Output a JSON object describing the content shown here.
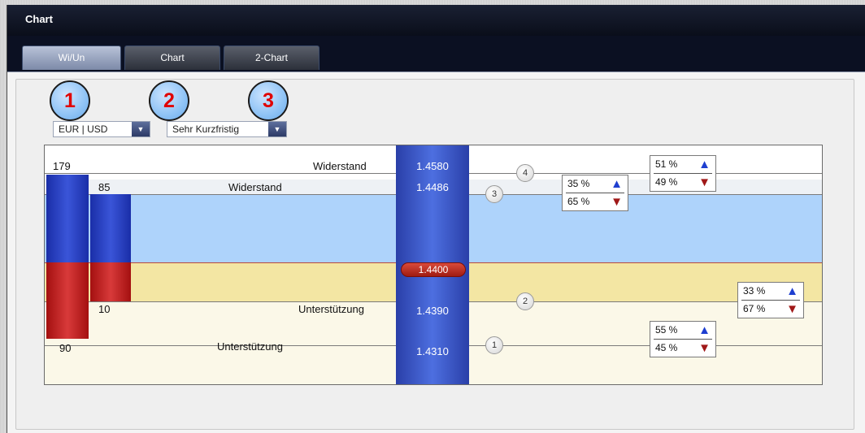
{
  "window": {
    "title": "Chart"
  },
  "tabs": [
    {
      "label": "Wi/Un",
      "active": true
    },
    {
      "label": "Chart",
      "active": false
    },
    {
      "label": "2-Chart",
      "active": false
    }
  ],
  "selectors": {
    "pair": {
      "value": "EUR | USD"
    },
    "horizon": {
      "value": "Sehr Kurzfristig"
    }
  },
  "badges": [
    "1",
    "2",
    "3"
  ],
  "levels": {
    "r2": {
      "count": "179",
      "label": "Widerstand",
      "price": "1.4580",
      "marker": "4",
      "up": "51 %",
      "down": "49 %"
    },
    "r1": {
      "count": "85",
      "label": "Widerstand",
      "price": "1.4486",
      "marker": "3",
      "up": "35 %",
      "down": "65 %"
    },
    "s1": {
      "count": "10",
      "label": "Unterstützung",
      "price": "1.4390",
      "marker": "2",
      "up": "33 %",
      "down": "67 %"
    },
    "s2": {
      "count": "90",
      "label": "Unterstützung",
      "price": "1.4310",
      "marker": "1",
      "up": "55 %",
      "down": "45 %"
    }
  },
  "current_price": "1.4400",
  "colors": {
    "resistance_band": "#aed3fb",
    "support_band": "#f3e6a3",
    "support_area": "#fbf8e8",
    "bar_blue": "#2238b8",
    "bar_red": "#b81818",
    "arrow_up": "#1f3fd0",
    "arrow_down": "#a01818"
  },
  "icons": {
    "arrow_up": "▲",
    "arrow_down": "▼",
    "dropdown": "▼"
  }
}
